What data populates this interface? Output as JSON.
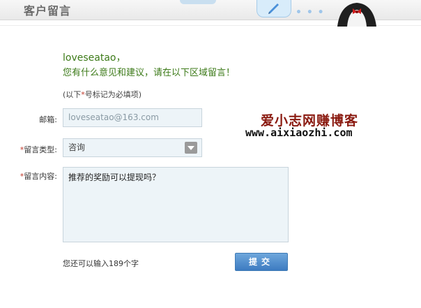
{
  "header": {
    "title": "客户留言"
  },
  "greeting": {
    "name": "loveseatao，",
    "message": "您有什么意见和建议，请在以下区域留言！"
  },
  "note": {
    "prefix": "(以下",
    "star": "*",
    "suffix": "号标记为必填项)"
  },
  "form": {
    "email": {
      "label": "邮箱:",
      "value": "loveseatao@163.com"
    },
    "type": {
      "required": "*",
      "label": "留言类型:",
      "selected": "咨询"
    },
    "content": {
      "required": "*",
      "label": "留言内容:",
      "value": "推荐的奖励可以提现吗？"
    },
    "counter": "您还可以输入189个字",
    "submit_label": "提交"
  },
  "watermark": {
    "title": "爱小志网赚博客",
    "url": "www.aixiaozhi.com"
  },
  "colors": {
    "accent": "#3d7bc1",
    "greeting": "#3c7a18",
    "required": "#c0392b",
    "field_bg": "#edf4f8"
  }
}
